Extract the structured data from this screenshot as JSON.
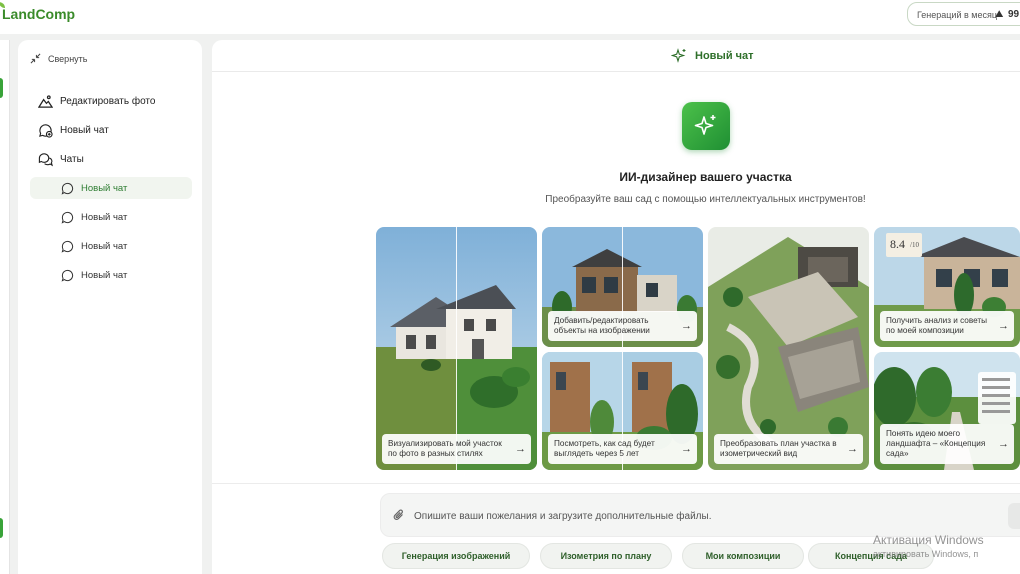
{
  "app": {
    "logo": "LandComp"
  },
  "header": {
    "generations_label": "Генераций в месяц",
    "generations_count": "99"
  },
  "sidebar": {
    "collapse_label": "Свернуть",
    "items": [
      {
        "label": "Редактировать фото",
        "icon": "mountain-photo-icon"
      },
      {
        "label": "Новый чат",
        "icon": "new-chat-icon"
      },
      {
        "label": "Чаты",
        "icon": "chats-icon"
      }
    ],
    "chats": [
      {
        "label": "Новый чат",
        "active": true
      },
      {
        "label": "Новый чат",
        "active": false
      },
      {
        "label": "Новый чат",
        "active": false
      },
      {
        "label": "Новый чат",
        "active": false
      }
    ]
  },
  "chat": {
    "title": "Новый чат"
  },
  "hero": {
    "title": "ИИ-дизайнер вашего участка",
    "subtitle": "Преобразуйте ваш сад с помощью интеллектуальных инструментов!"
  },
  "cards": [
    {
      "caption": "Визуализировать мой участок по фото в разных стилях"
    },
    {
      "caption": "Добавить/редактировать объекты на изображении"
    },
    {
      "caption": "Посмотреть, как сад будет выглядеть через 5 лет"
    },
    {
      "caption": "Преобразовать план участка в изометрический вид"
    },
    {
      "caption": "Получить анализ и советы по моей композиции",
      "score": "8.4",
      "score_unit": "/10"
    },
    {
      "caption": "Понять идею моего ландшафта – «Концепция сада»"
    }
  ],
  "prompt": {
    "placeholder": "Опишите ваши пожелания и загрузите дополнительные файлы."
  },
  "chips": [
    "Генерация изображений",
    "Изометрия по плану",
    "Мои композиции",
    "Концепция сада"
  ],
  "watermark": {
    "line1": "Активация Windows",
    "line2": "активировать Windows, п"
  },
  "colors": {
    "accent": "#2e9e3a",
    "accent_dark": "#2e6f2a",
    "background": "#f0f1f0"
  }
}
